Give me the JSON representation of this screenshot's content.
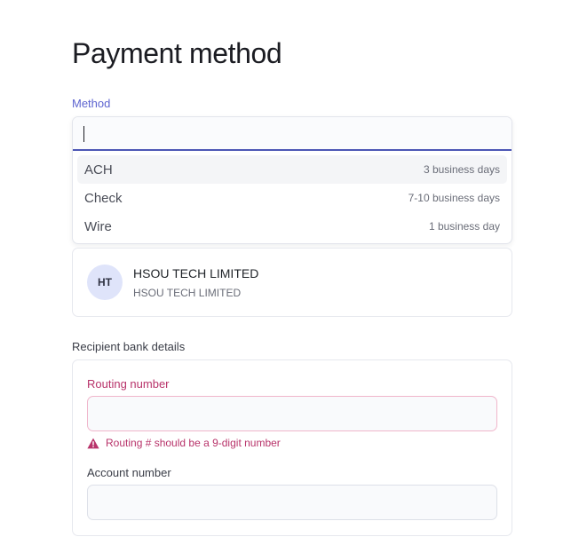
{
  "page": {
    "title": "Payment method"
  },
  "method": {
    "label": "Method",
    "value": "",
    "options": [
      {
        "label": "ACH",
        "meta": "3 business days",
        "highlighted": true
      },
      {
        "label": "Check",
        "meta": "7-10 business days",
        "highlighted": false
      },
      {
        "label": "Wire",
        "meta": "1 business day",
        "highlighted": false
      }
    ]
  },
  "recipient": {
    "initials": "HT",
    "name": "HSOU TECH LIMITED",
    "subtitle": "HSOU TECH LIMITED"
  },
  "bank_details": {
    "heading": "Recipient bank details",
    "routing": {
      "label": "Routing number",
      "value": "",
      "error": "Routing # should be a 9-digit number"
    },
    "account": {
      "label": "Account number",
      "value": ""
    }
  },
  "colors": {
    "accent": "#5d64d0",
    "focus_underline": "#4c56b5",
    "error": "#b8336a",
    "avatar_bg": "#dfe4fa"
  },
  "icons": {
    "warning": "warning-triangle-icon"
  }
}
